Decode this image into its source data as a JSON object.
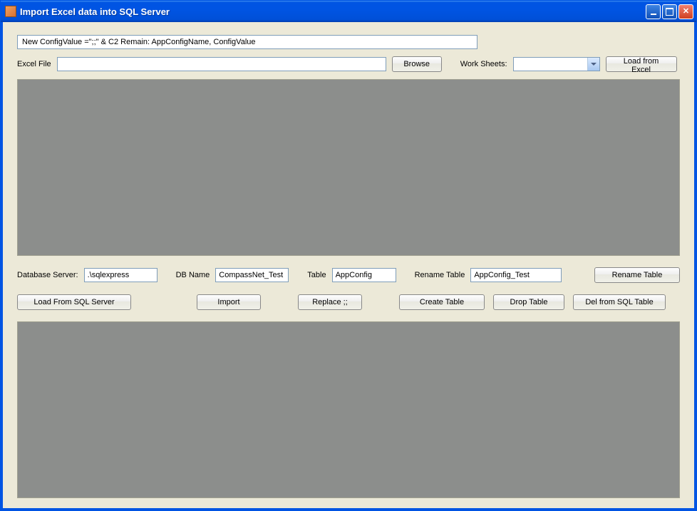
{
  "window": {
    "title": "Import Excel data into SQL Server"
  },
  "config": {
    "display": "New ConfigValue  =\";;\" & C2    Remain: AppConfigName, ConfigValue"
  },
  "excel": {
    "label": "Excel File",
    "path": "",
    "browse": "Browse",
    "worksheets_label": "Work Sheets:",
    "worksheet_selected": "",
    "load_button": "Load from Excel"
  },
  "db": {
    "server_label": "Database Server:",
    "server_value": ".\\sqlexpress",
    "dbname_label": "DB Name",
    "dbname_value": "CompassNet_Test",
    "table_label": "Table",
    "table_value": "AppConfig",
    "rename_label": "Rename Table",
    "rename_value": "AppConfig_Test",
    "rename_button": "Rename Table"
  },
  "actions": {
    "load_sql": "Load From SQL Server",
    "import": "Import",
    "replace": "Replace ;;",
    "create_table": "Create Table",
    "drop_table": "Drop Table",
    "del_from_sql": "Del from SQL Table"
  }
}
